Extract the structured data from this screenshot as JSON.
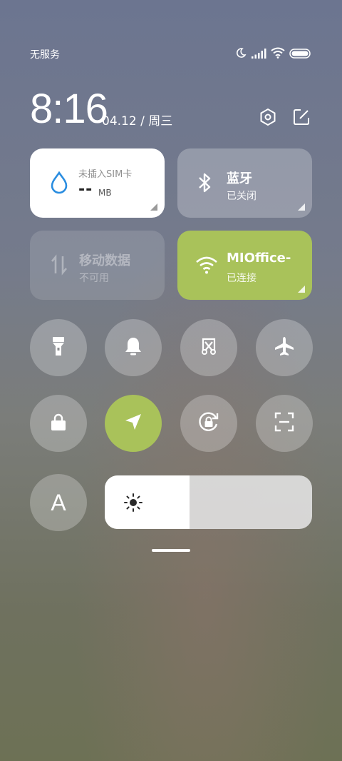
{
  "status_bar": {
    "carrier": "无服务",
    "icons": [
      "moon-icon",
      "signal-icon",
      "wifi-icon",
      "battery-icon"
    ]
  },
  "header": {
    "time": "8:16",
    "date": "04.12 / 周三",
    "icons": [
      "settings-icon",
      "edit-icon"
    ]
  },
  "tiles": {
    "data_usage": {
      "title": "未插入SIM卡",
      "value": "--",
      "unit": "MB",
      "icon": "water-drop-icon"
    },
    "bluetooth": {
      "title": "蓝牙",
      "status": "已关闭",
      "icon": "bluetooth-icon"
    },
    "mobile_data": {
      "title": "移动数据",
      "status": "不可用",
      "icon": "mobile-data-icon"
    },
    "wifi": {
      "title": "MIOffice-",
      "status": "已连接",
      "icon": "wifi-icon"
    }
  },
  "toggles": [
    {
      "name": "flashlight",
      "icon": "flashlight-icon",
      "active": false
    },
    {
      "name": "silent",
      "icon": "bell-icon",
      "active": false
    },
    {
      "name": "screenshot",
      "icon": "screenshot-scissors-icon",
      "active": false
    },
    {
      "name": "airplane",
      "icon": "airplane-icon",
      "active": false
    },
    {
      "name": "lock",
      "icon": "lock-icon",
      "active": false
    },
    {
      "name": "location",
      "icon": "location-arrow-icon",
      "active": true
    },
    {
      "name": "rotation-lock",
      "icon": "rotation-lock-icon",
      "active": false
    },
    {
      "name": "scanner",
      "icon": "scan-icon",
      "active": false
    },
    {
      "name": "auto-brightness",
      "icon": "letter-a-icon",
      "label": "A",
      "active": false
    }
  ],
  "brightness": {
    "level": 0.41,
    "icon": "sun-icon"
  },
  "colors": {
    "accent": "#a9c25a",
    "blue": "#2a8de0",
    "tile_inactive": "rgba(255,255,255,0.25)"
  }
}
